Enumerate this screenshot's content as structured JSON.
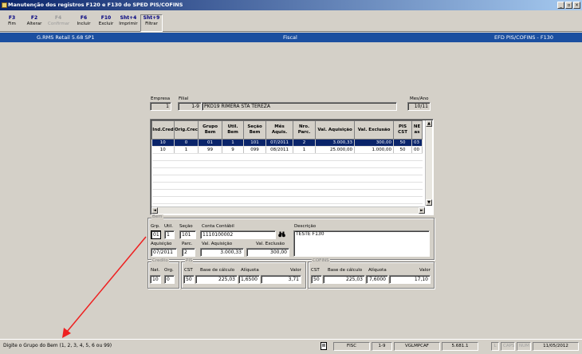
{
  "window": {
    "title": "Manutenção dos registros F120 e F130 do SPED PIS/COFINS",
    "btn_min": "_",
    "btn_max": "▫",
    "btn_close": "×"
  },
  "toolbar": [
    {
      "key": "F3",
      "label": "Fim",
      "disabled": false
    },
    {
      "key": "F2",
      "label": "Alterar",
      "disabled": false
    },
    {
      "key": "F4",
      "label": "Confirmar",
      "disabled": true
    },
    {
      "key": "F6",
      "label": "Incluir",
      "disabled": false
    },
    {
      "key": "F10",
      "label": "Excluir",
      "disabled": false
    },
    {
      "key": "Sht+4",
      "label": "Imprimir",
      "disabled": false
    },
    {
      "key": "Sht+9",
      "label": "Filtrar",
      "disabled": false
    }
  ],
  "header": {
    "app": "G.RMS Retail 5.68 SP1",
    "module": "Fiscal",
    "function": "EFD PIS/COFINS - F130"
  },
  "filters": {
    "empresa_label": "Empresa",
    "empresa": "1",
    "filial_label": "Filial",
    "filial_code": "1-9",
    "filial_name": "PKO19 RIMERA STA TEREZA",
    "mesano_label": "Mes/Ano",
    "mesano": "10/11"
  },
  "grid": {
    "columns": [
      "Ind.Cred",
      "Orig.Crec",
      "Grupo Bem",
      "Util. Bem",
      "Seção Bem",
      "Mês Aquis.",
      "Nro. Parc.",
      "Val. Aquisição",
      "Val. Exclusão",
      "PIS CST",
      "NE as"
    ],
    "rows": [
      [
        "10",
        "0",
        "01",
        "1",
        "101",
        "07/2011",
        "2",
        "3.000,33",
        "300,00",
        "50",
        "03"
      ],
      [
        "10",
        "1",
        "99",
        "9",
        "099",
        "08/2011",
        "1",
        "25.000,00",
        "1.000,00",
        "50",
        "00"
      ]
    ]
  },
  "bem": {
    "group_label": "Bem",
    "grp_label": "Grp.",
    "grp": "01",
    "util_label": "Util.",
    "util": "1",
    "secao_label": "Seção",
    "secao": "101",
    "conta_label": "Conta Contábil",
    "conta": "1110100002",
    "aquisicao_label": "Aquisição",
    "aquisicao": "07/2011",
    "parc_label": "Parc.",
    "parc": "2",
    "val_aq_label": "Val. Aquisição",
    "val_aq": "3.000,33",
    "val_ex_label": "Val. Exclusão",
    "val_ex": "300,00",
    "descricao_label": "Descrição",
    "descricao": "TESTE F130"
  },
  "credito": {
    "group_label": "Credito",
    "nat_label": "Nat.",
    "nat": "10",
    "org_label": "Org.",
    "org": "0"
  },
  "pis": {
    "group_label": "PIS",
    "cst_label": "CST",
    "cst": "50",
    "base_label": "Base de cálculo",
    "base": "225,03",
    "aliq_label": "Alíquota",
    "aliq": "1,6500",
    "valor_label": "Valor",
    "valor": "3,71"
  },
  "cofins": {
    "group_label": "COFINS",
    "cst_label": "CST",
    "cst": "50",
    "base_label": "Base de cálculo",
    "base": "225,03",
    "aliq_label": "Alíquota",
    "aliq": "7,6000",
    "valor_label": "Valor",
    "valor": "17,10"
  },
  "status": {
    "hint": "Digite o Grupo do Bem (1, 2, 3, 4, 5, 6 ou 99)",
    "system": "FISC",
    "filial": "1-9",
    "user": "VGLMPCAF",
    "version": "5.681.1",
    "caps": "CAPS",
    "num": "NUM",
    "lock": "L",
    "date": "11/05/2012"
  },
  "colors": {
    "header_blue": "#1b4fa0",
    "selection": "#0a246a",
    "arrow": "#ee2020"
  }
}
